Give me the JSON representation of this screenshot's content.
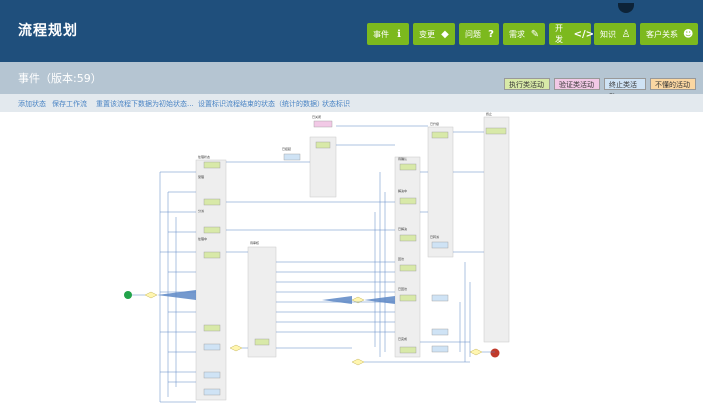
{
  "header": {
    "title": "流程规划",
    "nav": [
      {
        "label": "事件",
        "icon": "info-icon",
        "glyph": "ℹ"
      },
      {
        "label": "变更",
        "icon": "tag-icon",
        "glyph": "◆"
      },
      {
        "label": "问题",
        "icon": "question-icon",
        "glyph": "?"
      },
      {
        "label": "需求",
        "icon": "chat-icon",
        "glyph": "✎"
      },
      {
        "label": "开发",
        "icon": "code-icon",
        "glyph": "</>"
      },
      {
        "label": "知识",
        "icon": "person-icon",
        "glyph": "♙"
      },
      {
        "label": "客户关系",
        "icon": "users-icon",
        "glyph": "☻"
      }
    ]
  },
  "page": {
    "title": "事件（版本:59）"
  },
  "legend": [
    {
      "label": "执行类活动",
      "color": "#d8e9a8"
    },
    {
      "label": "验证类活动",
      "color": "#f2c9e6"
    },
    {
      "label": "终止类活动",
      "color": "#cfe3f5"
    },
    {
      "label": "不懂的活动",
      "color": "#fbd7a2"
    }
  ],
  "toolbar": [
    "添加状态",
    "保存工作流",
    "重置该流程下数据为初始状态...",
    "设置标识流程结束的状态（统计的数据）",
    "状态标识"
  ],
  "colors": {
    "topbar": "#1f4f7c",
    "nav_button": "#7cb91e",
    "subheader": "#b5c5d2",
    "link": "#4a84c4",
    "start_node": "#22a34a",
    "end_node": "#c0392b"
  }
}
